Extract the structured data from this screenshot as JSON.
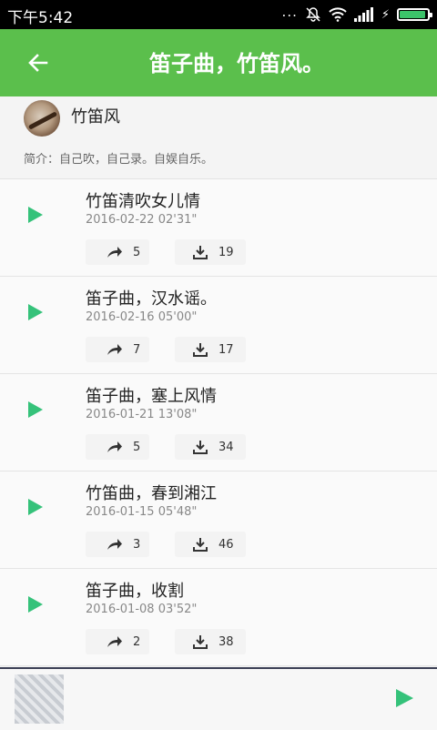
{
  "status_bar": {
    "time": "下午5:42",
    "dots": "...",
    "icons": [
      "mute-icon",
      "wifi-icon",
      "signal-icon",
      "charging-icon",
      "battery-icon"
    ]
  },
  "app_bar": {
    "title": "笛子曲，竹笛风。",
    "back_icon": "arrow-left-icon"
  },
  "author": {
    "name": "竹笛风",
    "intro": "简介：自己吹，自己录。自娱自乐。"
  },
  "tracks": [
    {
      "title": "竹笛清吹女儿情",
      "date": "2016-02-22",
      "duration": "02'31\"",
      "shares": "5",
      "downloads": "19"
    },
    {
      "title": "笛子曲，汉水谣。",
      "date": "2016-02-16",
      "duration": "05'00\"",
      "shares": "7",
      "downloads": "17"
    },
    {
      "title": "笛子曲，塞上风情",
      "date": "2016-01-21",
      "duration": "13'08\"",
      "shares": "5",
      "downloads": "34"
    },
    {
      "title": "竹笛曲，春到湘江",
      "date": "2016-01-15",
      "duration": "05'48\"",
      "shares": "3",
      "downloads": "46"
    },
    {
      "title": "笛子曲，收割",
      "date": "2016-01-08",
      "duration": "03'52\"",
      "shares": "2",
      "downloads": "38"
    }
  ],
  "colors": {
    "app_bar": "#5bbf4c",
    "play_accent": "#35c27a",
    "player_border": "#3b3f55"
  }
}
